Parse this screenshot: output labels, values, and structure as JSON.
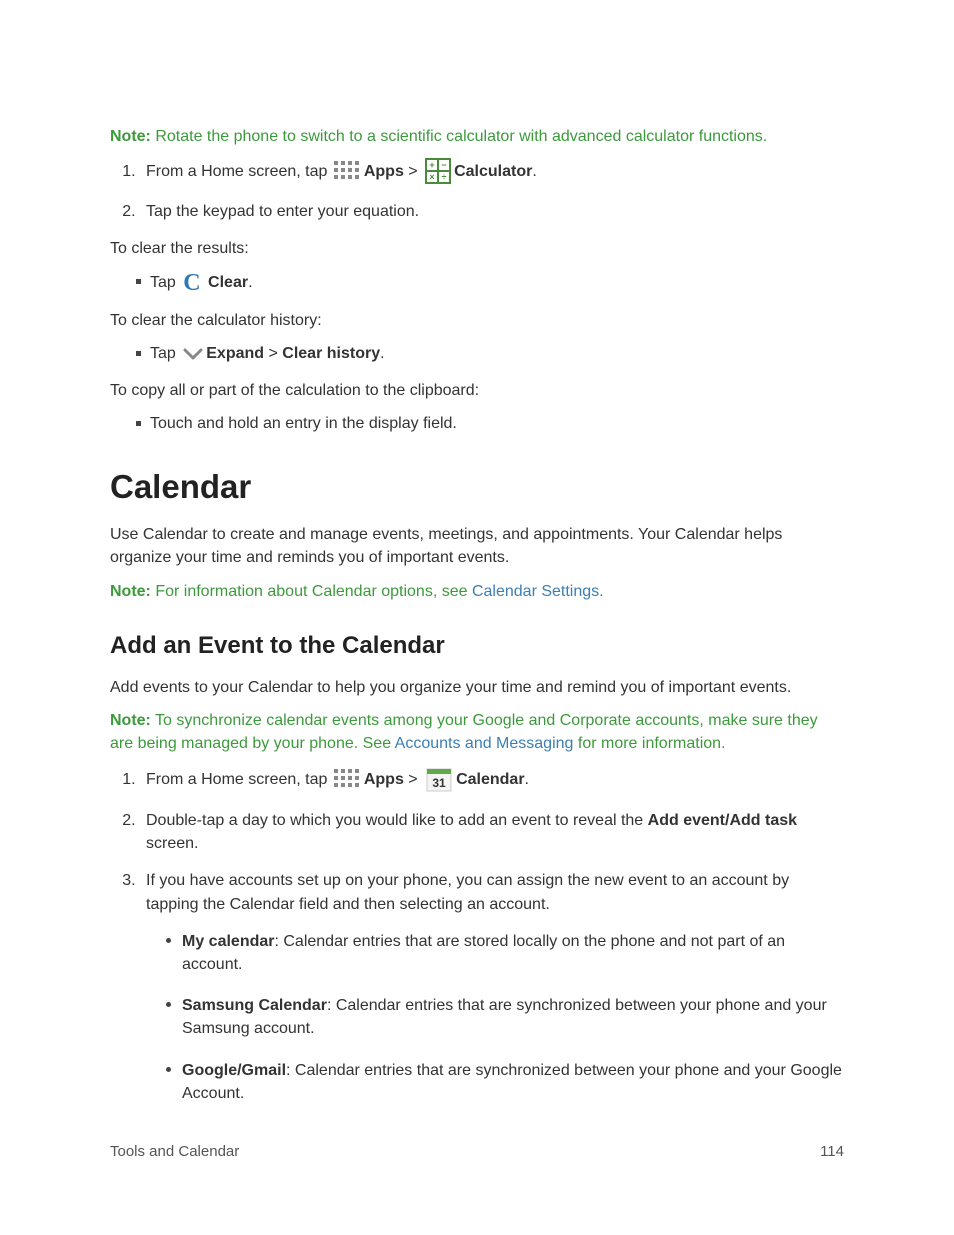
{
  "notes": {
    "rotate": {
      "label": "Note:",
      "text": " Rotate the phone to switch to a scientific calculator with advanced calculator functions."
    },
    "calendar_info": {
      "label": "Note:",
      "text_before_link": " For information about Calendar options, see ",
      "link": "Calendar Settings",
      "text_after_link": "."
    },
    "sync": {
      "label": "Note:",
      "text_before_link": " To synchronize calendar events among your Google and Corporate accounts, make sure they are being managed by your phone. See ",
      "link": "Accounts and Messaging",
      "text_after_link": " for more information."
    }
  },
  "calculator_steps": {
    "step1_prefix": "From a Home screen, tap ",
    "apps_label": "Apps",
    "sep": " > ",
    "calculator_label": "Calculator",
    "period": ".",
    "step2": "Tap the keypad to enter your equation."
  },
  "clear_results": {
    "intro": "To clear the results:",
    "tap": "Tap ",
    "clear_label": "Clear",
    "period": "."
  },
  "clear_history": {
    "intro": "To clear the calculator history:",
    "tap": "Tap ",
    "expand_label": "Expand",
    "sep": " > ",
    "clear_history_label": "Clear history",
    "period": "."
  },
  "copy_calc": {
    "intro": "To copy all or part of the calculation to the clipboard:",
    "bullet": "Touch and hold an entry in the display field."
  },
  "calendar": {
    "heading": "Calendar",
    "intro": "Use Calendar to create and manage events, meetings, and appointments. Your Calendar helps organize your time and reminds you of important events."
  },
  "add_event": {
    "heading": "Add an Event to the Calendar",
    "intro": "Add events to your Calendar to help you organize your time and remind you of important events.",
    "step1_prefix": "From a Home screen, tap ",
    "apps_label": "Apps",
    "sep": " > ",
    "calendar_label": "Calendar",
    "period": ".",
    "step2_prefix": "Double-tap a day to which you would like to add an event to reveal the ",
    "step2_bold": "Add event/Add task",
    "step2_suffix": " screen.",
    "step3": "If you have accounts set up on your phone, you can assign the new event to an account by tapping the Calendar field and then selecting an account.",
    "accounts": [
      {
        "name": "My calendar",
        "desc": ": Calendar entries that are stored locally on the phone and not part of an account."
      },
      {
        "name": "Samsung Calendar",
        "desc": ": Calendar entries that are synchronized between your phone and your Samsung account."
      },
      {
        "name": "Google/Gmail",
        "desc": ": Calendar entries that are synchronized between your phone and your Google Account."
      }
    ]
  },
  "icons": {
    "calendar_day": "31"
  },
  "footer": {
    "section": "Tools and Calendar",
    "page": "114"
  }
}
